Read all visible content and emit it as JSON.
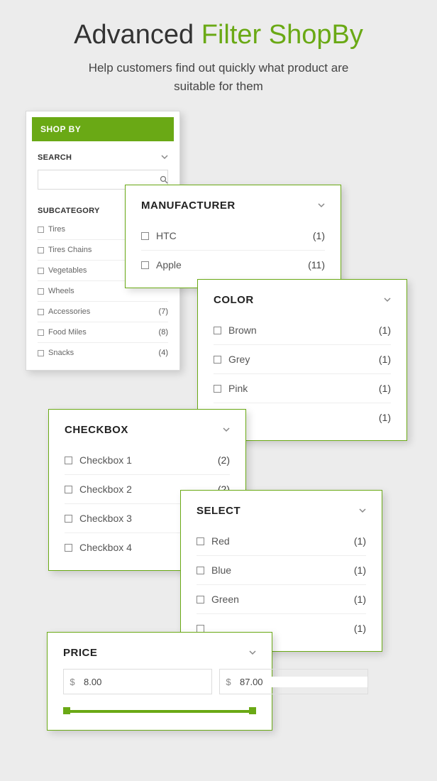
{
  "heading": {
    "prefix": "Advanced ",
    "accent": "Filter ShopBy",
    "sub1": "Help customers find out quickly what product are",
    "sub2": "suitable for them"
  },
  "shopby": {
    "header": "SHOP BY",
    "search_title": "SEARCH",
    "search_value": "",
    "subcat_title": "SUBCATEGORY",
    "items": [
      {
        "label": "Tires",
        "count": ""
      },
      {
        "label": "Tires Chains",
        "count": ""
      },
      {
        "label": "Vegetables",
        "count": ""
      },
      {
        "label": "Wheels",
        "count": ""
      },
      {
        "label": "Accessories",
        "count": "(7)"
      },
      {
        "label": "Food Miles",
        "count": "(8)"
      },
      {
        "label": "Snacks",
        "count": "(4)"
      }
    ]
  },
  "manufacturer": {
    "title": "MANUFACTURER",
    "items": [
      {
        "label": "HTC",
        "count": "(1)"
      },
      {
        "label": "Apple",
        "count": "(11)"
      }
    ]
  },
  "color": {
    "title": "COLOR",
    "items": [
      {
        "label": "Brown",
        "count": "(1)"
      },
      {
        "label": "Grey",
        "count": "(1)"
      },
      {
        "label": "Pink",
        "count": "(1)"
      },
      {
        "label": "",
        "count": "(1)"
      }
    ]
  },
  "checkbox": {
    "title": "CHECKBOX",
    "items": [
      {
        "label": "Checkbox 1",
        "count": "(2)"
      },
      {
        "label": "Checkbox 2",
        "count": "(2)"
      },
      {
        "label": "Checkbox 3",
        "count": ""
      },
      {
        "label": "Checkbox 4",
        "count": ""
      }
    ]
  },
  "select": {
    "title": "SELECT",
    "items": [
      {
        "label": "Red",
        "count": "(1)"
      },
      {
        "label": "Blue",
        "count": "(1)"
      },
      {
        "label": "Green",
        "count": "(1)"
      },
      {
        "label": "",
        "count": "(1)"
      }
    ]
  },
  "price": {
    "title": "PRICE",
    "currency": "$",
    "min": "8.00",
    "max": "87.00"
  }
}
